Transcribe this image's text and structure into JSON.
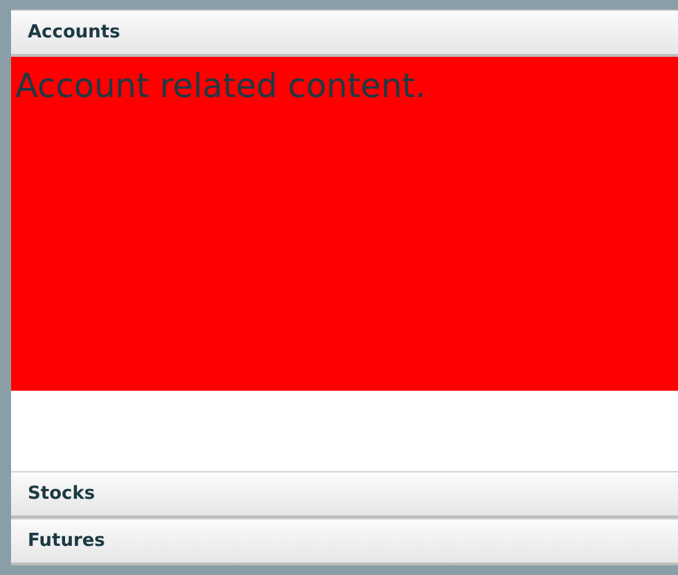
{
  "panels": [
    {
      "title": "Accounts",
      "expanded": true,
      "content": "Account related content."
    },
    {
      "title": "Stocks",
      "expanded": false
    },
    {
      "title": "Futures",
      "expanded": false
    }
  ]
}
